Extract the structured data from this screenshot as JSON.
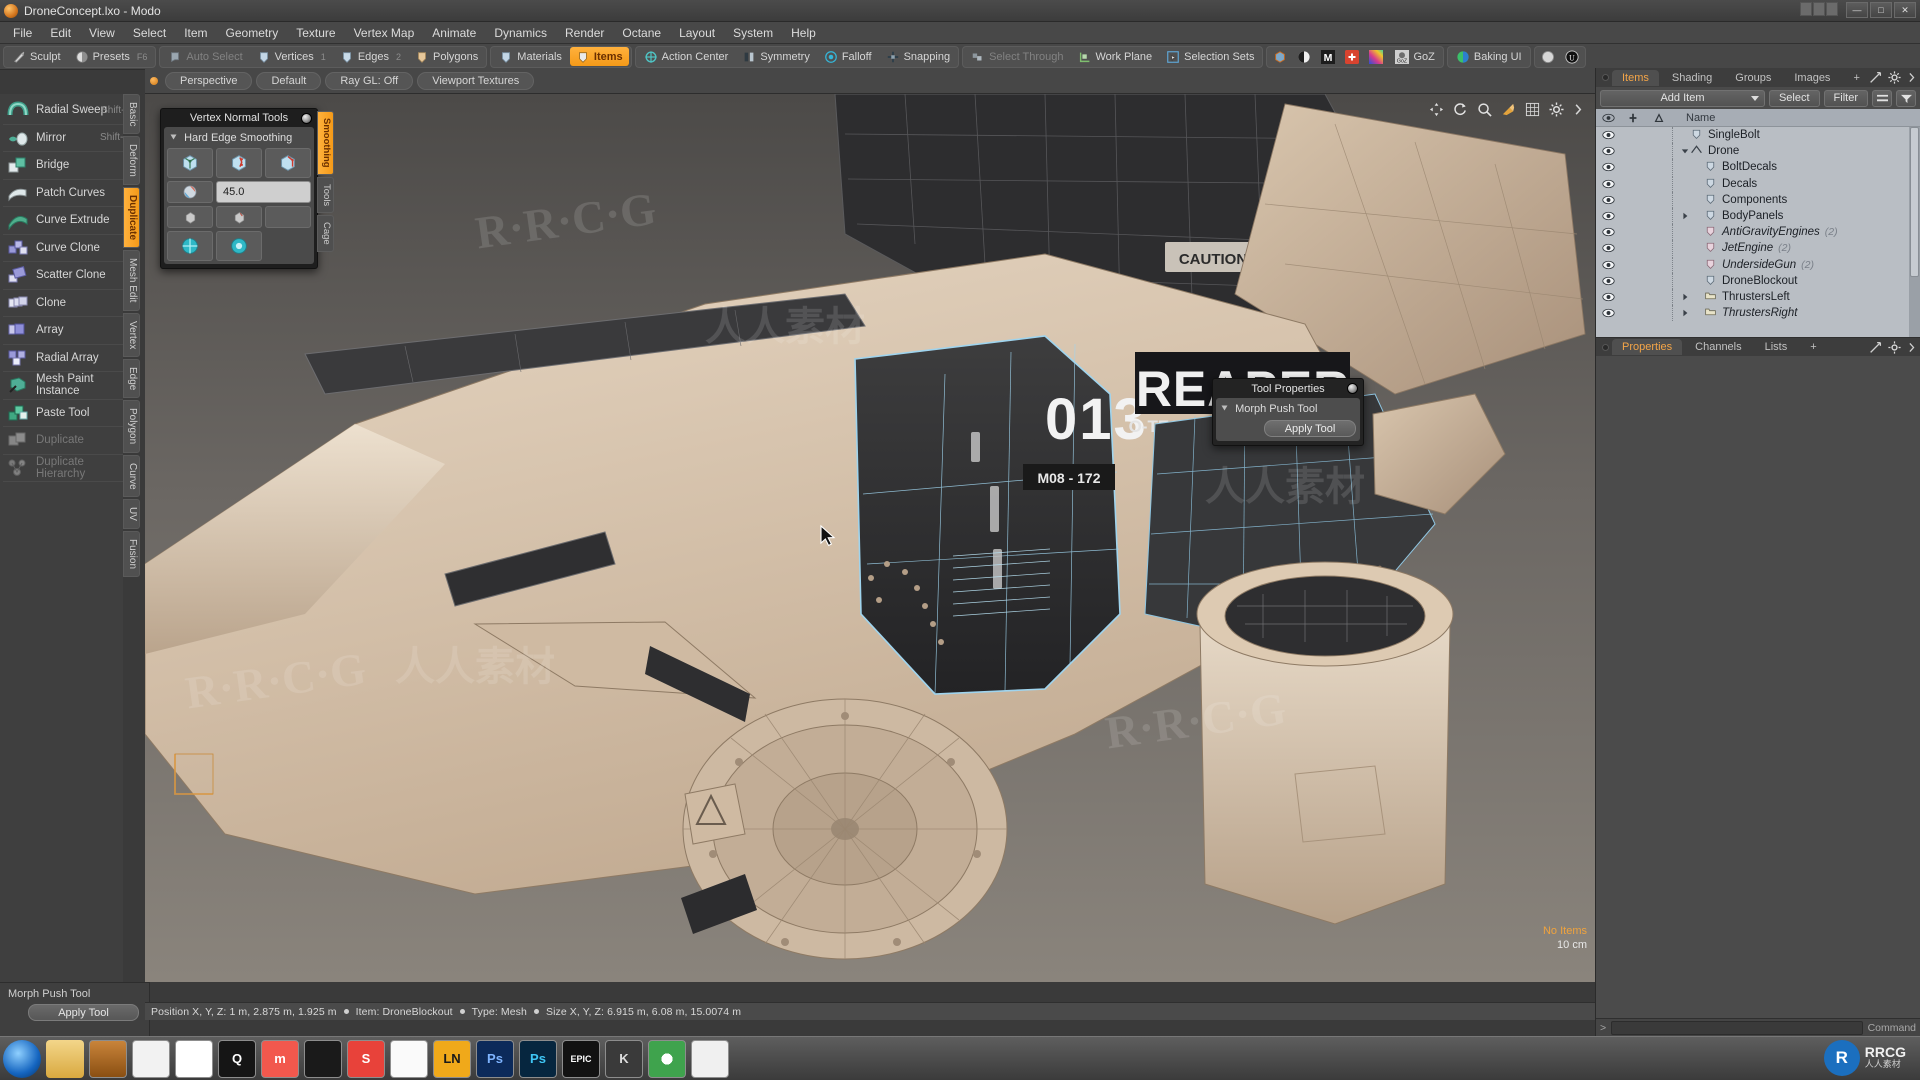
{
  "window": {
    "title": "DroneConcept.lxo - Modo",
    "app_icon": "modo-icon",
    "min_label": "—",
    "max_label": "□",
    "close_label": "✕"
  },
  "menubar": {
    "items": [
      "File",
      "Edit",
      "View",
      "Select",
      "Item",
      "Geometry",
      "Texture",
      "Vertex Map",
      "Animate",
      "Dynamics",
      "Render",
      "Octane",
      "Layout",
      "System",
      "Help"
    ]
  },
  "toolbar": {
    "left_group": [
      {
        "label": "Sculpt",
        "icon": "sculpt-icon",
        "state": "normal",
        "shortcut": ""
      },
      {
        "label": "Presets",
        "icon": "presets-icon",
        "state": "normal",
        "shortcut": "F6"
      }
    ],
    "mode_group": [
      {
        "label": "Auto Select",
        "icon": "auto-select-icon",
        "state": "dim",
        "shortcut": ""
      },
      {
        "label": "Vertices",
        "icon": "vertices-icon",
        "state": "normal",
        "shortcut": "1"
      },
      {
        "label": "Edges",
        "icon": "edges-icon",
        "state": "normal",
        "shortcut": "2"
      },
      {
        "label": "Polygons",
        "icon": "polygons-icon",
        "state": "normal",
        "shortcut": "3"
      }
    ],
    "item_group": [
      {
        "label": "Materials",
        "icon": "materials-icon",
        "state": "normal",
        "shortcut": ""
      },
      {
        "label": "Items",
        "icon": "items-icon",
        "state": "active",
        "shortcut": ""
      }
    ],
    "center_group": [
      {
        "label": "Action Center",
        "icon": "action-center-icon",
        "state": "normal"
      },
      {
        "label": "Symmetry",
        "icon": "symmetry-icon",
        "state": "normal"
      },
      {
        "label": "Falloff",
        "icon": "falloff-icon",
        "state": "normal"
      },
      {
        "label": "Snapping",
        "icon": "snapping-icon",
        "state": "normal"
      }
    ],
    "select_group": [
      {
        "label": "Select Through",
        "icon": "select-through-icon",
        "state": "dim"
      },
      {
        "label": "Work Plane",
        "icon": "work-plane-icon",
        "state": "normal"
      },
      {
        "label": "Selection Sets",
        "icon": "selection-sets-icon",
        "state": "normal"
      }
    ],
    "plugin_icons": [
      "cube-blue-icon",
      "sphere-shade-icon",
      "m-letter-icon",
      "plus-red-icon",
      "gradient-icon"
    ],
    "goz_label": "GoZ",
    "goz_icon": "goz-icon",
    "baking_label": "Baking UI",
    "baking_icon": "baking-icon",
    "far_icons": [
      "sphere-grey-icon",
      "unreal-icon"
    ]
  },
  "left_tabs": {
    "items": [
      "Basic",
      "Deform",
      "Duplicate",
      "Mesh Edit",
      "Vertex",
      "Edge",
      "Polygon",
      "Curve",
      "UV",
      "Fusion"
    ],
    "active": "Duplicate"
  },
  "left_tools": {
    "items": [
      {
        "label": "Radial Sweep",
        "shortcut": "Shift-L",
        "icon": "radial-sweep-icon",
        "disabled": false,
        "corner": false
      },
      {
        "label": "Mirror",
        "shortcut": "Shift-V",
        "icon": "mirror-icon",
        "disabled": false,
        "corner": true
      },
      {
        "label": "Bridge",
        "shortcut": "",
        "icon": "bridge-icon",
        "disabled": false,
        "corner": false
      },
      {
        "label": "Patch Curves",
        "shortcut": "",
        "icon": "patch-curves-icon",
        "disabled": false,
        "corner": false
      },
      {
        "label": "Curve Extrude",
        "shortcut": "",
        "icon": "curve-extrude-icon",
        "disabled": false,
        "corner": true
      },
      {
        "label": "Curve Clone",
        "shortcut": "",
        "icon": "curve-clone-icon",
        "disabled": false,
        "corner": true
      },
      {
        "label": "Scatter Clone",
        "shortcut": "",
        "icon": "scatter-clone-icon",
        "disabled": false,
        "corner": true
      },
      {
        "label": "Clone",
        "shortcut": "",
        "icon": "clone-icon",
        "disabled": false,
        "corner": true
      },
      {
        "label": "Array",
        "shortcut": "",
        "icon": "array-icon",
        "disabled": false,
        "corner": true
      },
      {
        "label": "Radial Array",
        "shortcut": "",
        "icon": "radial-array-icon",
        "disabled": false,
        "corner": true
      },
      {
        "label": "Mesh Paint Instance",
        "shortcut": "",
        "icon": "mesh-paint-instance-icon",
        "disabled": false,
        "corner": true
      },
      {
        "label": "Paste Tool",
        "shortcut": "",
        "icon": "paste-tool-icon",
        "disabled": false,
        "corner": false
      },
      {
        "label": "Duplicate",
        "shortcut": "",
        "icon": "duplicate-icon",
        "disabled": true,
        "corner": false
      },
      {
        "label": "Duplicate Hierarchy",
        "shortcut": "",
        "icon": "duplicate-hierarchy-icon",
        "disabled": true,
        "corner": false
      }
    ]
  },
  "morph_dock": {
    "title": "Morph Push Tool",
    "apply_label": "Apply Tool"
  },
  "viewport_header": {
    "tabs": [
      "Perspective",
      "Default",
      "Ray GL: Off",
      "Viewport Textures"
    ],
    "gizmo_icons": [
      "pan-icon",
      "rotate-icon",
      "zoom-icon",
      "move-icon",
      "grid-icon",
      "gear-icon",
      "chevron-right-icon"
    ]
  },
  "vertex_normal_tools": {
    "title": "Vertex Normal Tools",
    "section": "Hard Edge Smoothing",
    "angle_value": "45.0",
    "side_tabs": [
      "Smoothing",
      "Tools",
      "Cage"
    ],
    "side_active": "Smoothing",
    "buttons": [
      {
        "icon": "cube-normals-icon"
      },
      {
        "icon": "cube-hard-edge-icon"
      },
      {
        "icon": "cube-soft-edge-icon"
      },
      {
        "icon": "cube-angle-icon"
      },
      {
        "icon": "cube-plain-a-icon"
      },
      {
        "icon": "cube-plain-b-icon"
      },
      {
        "icon": "cube-teal-a-icon"
      },
      {
        "icon": "cube-teal-b-icon"
      }
    ]
  },
  "tool_properties": {
    "title": "Tool Properties",
    "section": "Morph Push Tool",
    "apply_label": "Apply Tool"
  },
  "right_panel": {
    "tabs": [
      "Items",
      "Shading",
      "Groups",
      "Images"
    ],
    "active_tab": "Items",
    "add_tab_label": "+",
    "add_item_label": "Add Item",
    "select_label": "Select",
    "filter_label": "Filter",
    "columns": [
      "eye-icon",
      "lock-icon",
      "render-icon",
      "Name"
    ],
    "items": [
      {
        "name": "SingleBolt",
        "indent": 1,
        "icon": "mesh-icon",
        "italic": false,
        "count": "",
        "twist": "none"
      },
      {
        "name": "Drone",
        "indent": 1,
        "icon": "locator-icon",
        "italic": false,
        "count": "",
        "twist": "open"
      },
      {
        "name": "BoltDecals",
        "indent": 2,
        "icon": "mesh-icon",
        "italic": false,
        "count": "",
        "twist": "none"
      },
      {
        "name": "Decals",
        "indent": 2,
        "icon": "mesh-icon",
        "italic": false,
        "count": "",
        "twist": "none"
      },
      {
        "name": "Components",
        "indent": 2,
        "icon": "mesh-icon",
        "italic": false,
        "count": "",
        "twist": "none"
      },
      {
        "name": "BodyPanels",
        "indent": 2,
        "icon": "mesh-icon",
        "italic": false,
        "count": "",
        "twist": "closed"
      },
      {
        "name": "AntiGravityEngines",
        "indent": 2,
        "icon": "mesh-pink-icon",
        "italic": true,
        "count": "(2)",
        "twist": "none"
      },
      {
        "name": "JetEngine",
        "indent": 2,
        "icon": "mesh-pink-icon",
        "italic": true,
        "count": "(2)",
        "twist": "none"
      },
      {
        "name": "UndersideGun",
        "indent": 2,
        "icon": "mesh-pink-icon",
        "italic": true,
        "count": "(2)",
        "twist": "none"
      },
      {
        "name": "DroneBlockout",
        "indent": 2,
        "icon": "mesh-icon",
        "italic": false,
        "count": "",
        "twist": "none"
      },
      {
        "name": "ThrustersLeft",
        "indent": 2,
        "icon": "group-icon",
        "italic": false,
        "count": "",
        "twist": "closed"
      },
      {
        "name": "ThrustersRight",
        "indent": 2,
        "icon": "group-icon",
        "italic": true,
        "count": "",
        "twist": "closed"
      }
    ],
    "lower_tabs": [
      "Properties",
      "Channels",
      "Lists"
    ],
    "lower_active": "Properties",
    "lower_add_label": "+",
    "command_prompt": ">",
    "command_label": "Command"
  },
  "viewport": {
    "no_items_label": "No Items",
    "grid_unit": "10 cm",
    "decals": {
      "number": "013",
      "sub": "M08 - 172",
      "brand": "REAPER",
      "brand_sub": "O-TECH INDUSTRIES",
      "caution": "CAUTION"
    }
  },
  "statusbar": {
    "position_label": "Position X, Y, Z:",
    "position_value": "1 m, 2.875 m, 1.925 m",
    "item_label": "Item:",
    "item_value": "DroneBlockout",
    "type_label": "Type:",
    "type_value": "Mesh",
    "size_label": "Size X, Y, Z:",
    "size_value": "6.915 m, 6.08 m, 15.0074 m"
  },
  "taskbar": {
    "items": [
      {
        "name": "start-orb",
        "label": ""
      },
      {
        "name": "explorer",
        "label": ""
      },
      {
        "name": "modo",
        "label": ""
      },
      {
        "name": "zbrush",
        "label": ""
      },
      {
        "name": "steam",
        "label": ""
      },
      {
        "name": "quixel",
        "label": "Q"
      },
      {
        "name": "marmoset",
        "label": "m"
      },
      {
        "name": "substance-painter",
        "label": ""
      },
      {
        "name": "substance-designer",
        "label": "S"
      },
      {
        "name": "quixel-bridge",
        "label": ""
      },
      {
        "name": "layout-ln",
        "label": "LN"
      },
      {
        "name": "photoshop-1",
        "label": "Ps"
      },
      {
        "name": "photoshop-2",
        "label": "Ps"
      },
      {
        "name": "epic-games",
        "label": "EPIC"
      },
      {
        "name": "keyshot",
        "label": "K"
      },
      {
        "name": "chrome",
        "label": ""
      },
      {
        "name": "unreal-engine",
        "label": ""
      }
    ]
  },
  "watermarks": {
    "brand": "RRCG",
    "cn": "人人素材",
    "logo_text": "RRCG",
    "logo_sub": "人人素材"
  },
  "colors": {
    "accent": "#f5a623",
    "panel": "#3f3f3f",
    "toolbar": "#474747",
    "list_bg": "#b9bec4",
    "viewport_bg": "#6e6a66",
    "body_tan": "#d8c4ad",
    "dark_panel": "#3a3a3a"
  }
}
